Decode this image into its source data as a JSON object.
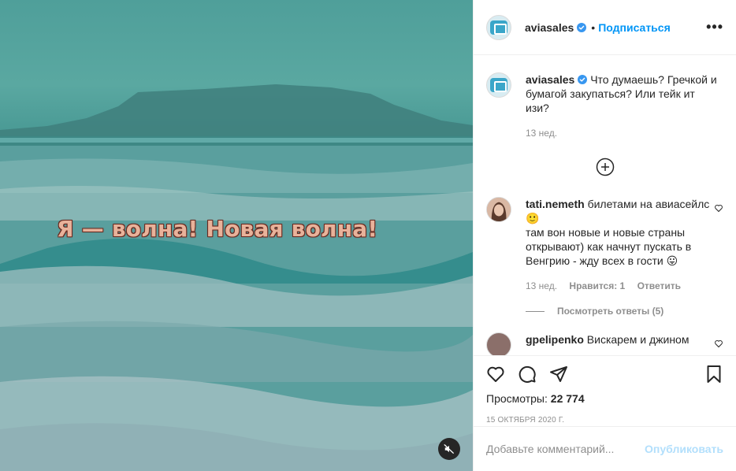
{
  "media": {
    "overlay_text": "Я — волна! Новая волна!",
    "mute_icon": "speaker-muted-icon"
  },
  "header": {
    "username": "aviasales",
    "follow_label": "Подписаться",
    "separator": "•",
    "more_label": "•••"
  },
  "caption": {
    "username": "aviasales",
    "text": "Что думаешь? Гречкой и бумагой закупаться? Или тейк ит изи?",
    "time": "13 нед."
  },
  "comments": [
    {
      "username": "tati.nemeth",
      "line1": "билетами на авиасейлс 🙂",
      "line2": "там вон новые и новые страны открывают) как начнут пускать в Венгрию - жду всех в гости 😛",
      "time": "13 нед.",
      "likes": "Нравится: 1",
      "reply": "Ответить",
      "view_replies": "Посмотреть ответы (5)"
    },
    {
      "username": "gpelipenko",
      "text": "Вискарем и джином"
    }
  ],
  "stats": {
    "views_label": "Просмотры:",
    "views_value": "22 774",
    "date": "15 ОКТЯБРЯ 2020 Г."
  },
  "add_comment": {
    "placeholder": "Добавьте комментарий...",
    "publish_label": "Опубликовать"
  },
  "colors": {
    "accent": "#0095f6",
    "publish_disabled": "#b2dffc",
    "muted_text": "#8e8e8e"
  }
}
